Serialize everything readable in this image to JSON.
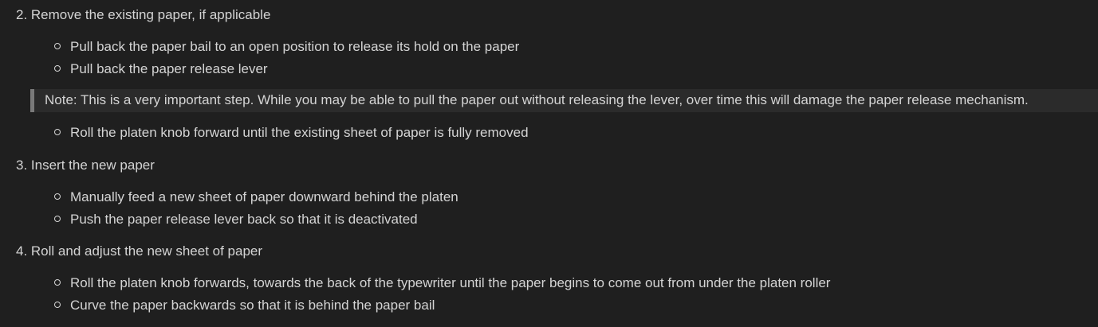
{
  "steps": [
    {
      "heading": "2. Remove the existing paper, if applicable",
      "bullets": [
        "Pull back the paper bail to an open position to release its hold on the paper",
        "Pull back the paper release lever"
      ],
      "note": "Note: This is a very important step. While you may be able to pull the paper out without releasing the lever, over time this will damage the paper release mechanism.",
      "bullets_after_note": [
        "Roll the platen knob forward until the existing sheet of paper is fully removed"
      ]
    },
    {
      "heading": "3. Insert the new paper",
      "bullets": [
        "Manually feed a new sheet of paper downward behind the platen",
        "Push the paper release lever back so that it is deactivated"
      ]
    },
    {
      "heading": "4. Roll and adjust the new sheet of paper",
      "bullets": [
        "Roll the platen knob forwards, towards the back of the typewriter until the paper begins to come out from under the platen roller",
        "Curve the paper backwards so that it is behind the paper bail"
      ]
    }
  ]
}
